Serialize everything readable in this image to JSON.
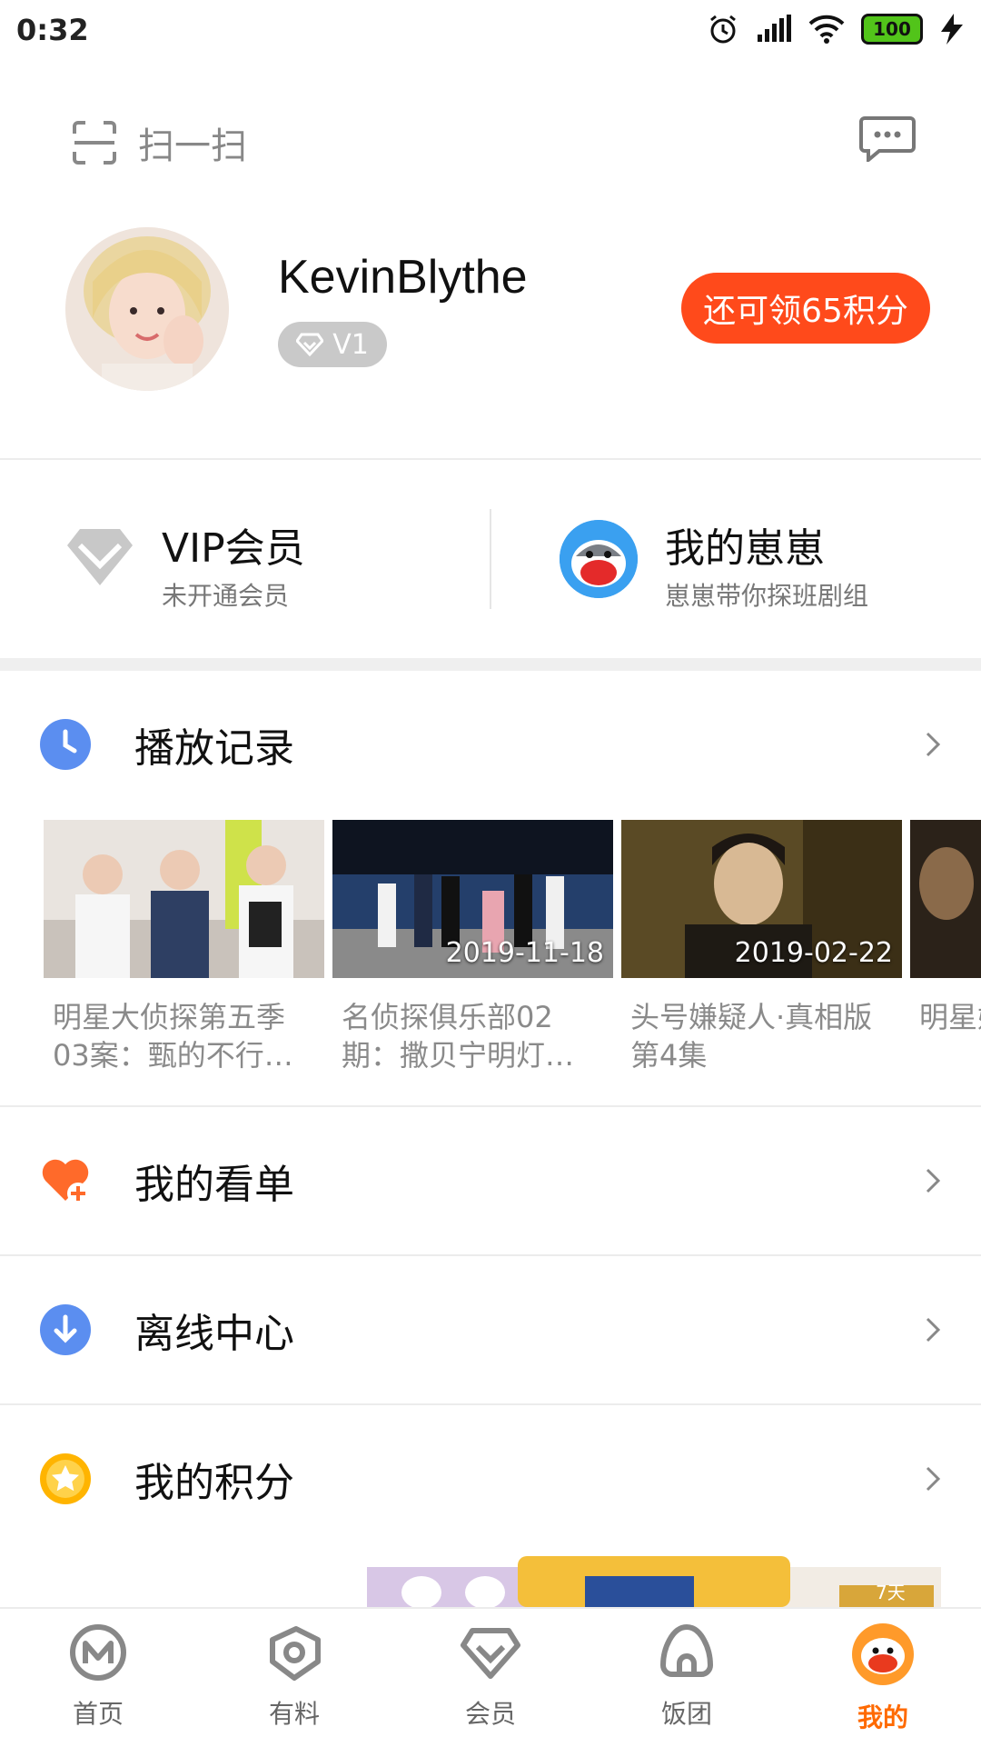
{
  "status": {
    "time": "0:32",
    "battery": "100"
  },
  "top": {
    "scan_label": "扫一扫"
  },
  "profile": {
    "username": "KevinBlythe",
    "level": "V1",
    "points_button": "还可领65积分"
  },
  "vip": {
    "title": "VIP会员",
    "subtitle": "未开通会员"
  },
  "zaizai": {
    "title": "我的崽崽",
    "subtitle": "崽崽带你探班剧组"
  },
  "history": {
    "label": "播放记录",
    "items": [
      {
        "date": "",
        "title": "明星大侦探第五季 03案：甄的不行…"
      },
      {
        "date": "2019-11-18",
        "title": "名侦探俱乐部02期：撒贝宁明灯…"
      },
      {
        "date": "2019-02-22",
        "title": "头号嫌疑人·真相版 第4集"
      },
      {
        "date": "",
        "title": "明星嫌疑"
      }
    ]
  },
  "menu": {
    "watchlist": "我的看单",
    "offline": "离线中心",
    "points": "我的积分"
  },
  "banner": {
    "text": "7天"
  },
  "nav": {
    "home": "首页",
    "youliao": "有料",
    "member": "会员",
    "fantuan": "饭团",
    "mine": "我的"
  },
  "colors": {
    "accent": "#ff4a1b",
    "nav_active": "#ff6a00",
    "blue_icon": "#5b8ef0",
    "heart_icon": "#ff6a2a",
    "star_icon": "#ffb400"
  }
}
